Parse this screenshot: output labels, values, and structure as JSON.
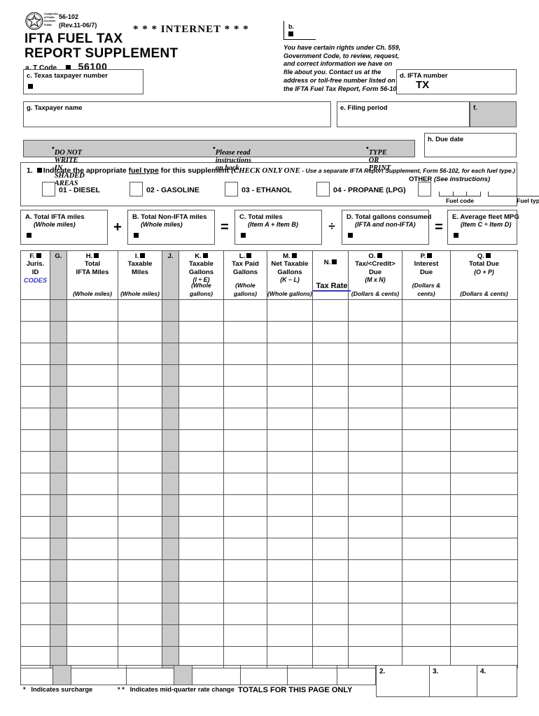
{
  "form": {
    "agency_seal_text": "Comptroller of Public Accounts FORM",
    "form_number": "56-102",
    "revision": "(Rev.11-06/7)",
    "title_line1": "IFTA  FUEL TAX",
    "title_line2": "REPORT  SUPPLEMENT",
    "tcode_label": "a. T Code",
    "tcode_value": "56100",
    "internet_banner": "* * *  INTERNET  * * *"
  },
  "fields": {
    "b_label": "b.",
    "rights_notice": "You have certain rights under Ch. 559, Government Code, to review, request, and correct information we have on file about you.  Contact us at the address or toll-free number listed on the IFTA Fuel Tax Report, Form 56-101.",
    "taxpayer_number_label": "c. Texas taxpayer number",
    "ifta_number_label": "d. IFTA number",
    "ifta_number_value": "TX",
    "taxpayer_name_label": "g. Taxpayer name",
    "filing_period_label": "e. Filing period",
    "f_label": "f.",
    "due_date_label": "h. Due date"
  },
  "instructions": {
    "item1": "DO NOT WRITE IN SHADED AREAS",
    "item2": "Please read instructions on back",
    "item3": "TYPE OR PRINT"
  },
  "fuel_section": {
    "number": "1.",
    "prompt_a": "Indicate the appropriate ",
    "prompt_underlined": "fuel type",
    "prompt_b": " for this supplement ",
    "paren_caps": "(CHECK ONLY ONE",
    "paren_rest": " - Use a separate IFTA Report Supplement, Form 56-102, for each fuel type.)",
    "options": [
      {
        "label": "01 - DIESEL"
      },
      {
        "label": "02 - GASOLINE"
      },
      {
        "label": "03 - ETHANOL"
      },
      {
        "label": "04 - PROPANE (LPG)"
      }
    ],
    "other_label": "OTHER",
    "other_note": "(See instructions)",
    "fuel_code_label": "Fuel code",
    "fuel_type_label": "Fuel type"
  },
  "calc_boxes": [
    {
      "id": "A",
      "title": "A. Total IFTA miles",
      "sub": "(Whole miles)"
    },
    {
      "id": "B",
      "title": "B. Total Non-IFTA miles",
      "sub": "(Whole miles)"
    },
    {
      "id": "C",
      "title": "C. Total miles",
      "sub": "(Item A + Item B)"
    },
    {
      "id": "D",
      "title": "D. Total gallons consumed",
      "sub": "(IFTA and non-IFTA)"
    },
    {
      "id": "E",
      "title": "E. Average fleet MPG",
      "sub": "(Item C ÷ Item D)"
    }
  ],
  "operators": {
    "plus": "+",
    "equals1": "=",
    "divide": "÷",
    "equals2": "="
  },
  "table": {
    "columns": [
      {
        "key": "F",
        "head": "F.",
        "lines": [
          "Juris.",
          "ID"
        ],
        "codes": "CODES",
        "unit": "",
        "shaded": false
      },
      {
        "key": "G",
        "head": "G.",
        "lines": [],
        "unit": "",
        "shaded": true
      },
      {
        "key": "H",
        "head": "H.",
        "lines": [
          "Total",
          "IFTA Miles"
        ],
        "unit": "(Whole miles)",
        "shaded": false
      },
      {
        "key": "I",
        "head": "I.",
        "lines": [
          "Taxable",
          "Miles"
        ],
        "unit": "(Whole miles)",
        "shaded": false
      },
      {
        "key": "J",
        "head": "J.",
        "lines": [],
        "unit": "",
        "shaded": true
      },
      {
        "key": "K",
        "head": "K.",
        "lines": [
          "Taxable",
          "Gallons"
        ],
        "italic": "(I ÷ E)",
        "unit": "(Whole gallons)",
        "shaded": false
      },
      {
        "key": "L",
        "head": "L.",
        "lines": [
          "Tax Paid",
          "Gallons"
        ],
        "unit": "(Whole gallons)",
        "shaded": false
      },
      {
        "key": "M",
        "head": "M.",
        "lines": [
          "Net Taxable",
          "Gallons"
        ],
        "italic": "(K −  L)",
        "unit": "(Whole gallons)",
        "shaded": false
      },
      {
        "key": "N",
        "head": "N.",
        "lines": [],
        "taxrate": "Tax Rate",
        "unit": "",
        "shaded": false
      },
      {
        "key": "O",
        "head": "O.",
        "lines": [
          "Tax/<Credit>",
          "Due"
        ],
        "italic": "(M  x  N)",
        "unit": "(Dollars & cents)",
        "shaded": false
      },
      {
        "key": "P",
        "head": "P.",
        "lines": [
          "Interest",
          "Due"
        ],
        "unit": "(Dollars & cents)",
        "shaded": false
      },
      {
        "key": "Q",
        "head": "Q.",
        "lines": [
          "Total Due"
        ],
        "italic": "(O  +  P)",
        "unit": "(Dollars & cents)",
        "shaded": false
      }
    ],
    "row_count": 17,
    "rows": []
  },
  "totals": {
    "box2_label": "2.",
    "box3_label": "3.",
    "box4_label": "4.",
    "caption": "TOTALS FOR THIS PAGE ONLY"
  },
  "footnotes": {
    "surcharge": "Indicates surcharge",
    "surcharge_mark": "*",
    "midquarter": "Indicates mid-quarter rate change",
    "midquarter_mark": "* *"
  },
  "colors": {
    "shade": "#c9c9c9",
    "accent_blue": "#3838c4",
    "border": "#555555"
  }
}
